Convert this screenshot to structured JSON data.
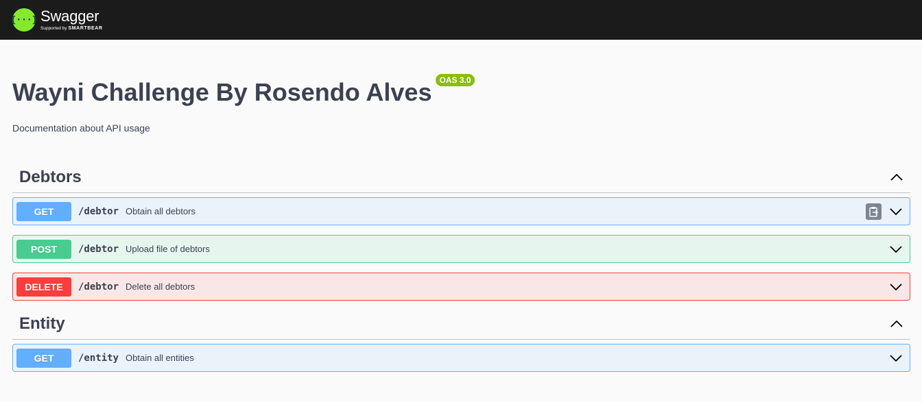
{
  "topbar": {
    "logo_mark": "{···}",
    "brand": "Swagger",
    "supported_by": "Supported by",
    "smartbear": "SMARTBEAR"
  },
  "info": {
    "title": "Wayni Challenge By Rosendo Alves",
    "version_badge": "OAS 3.0",
    "description": "Documentation about API usage"
  },
  "tags": [
    {
      "name": "Debtors",
      "toggle_icon": "chevron-up-icon",
      "operations": [
        {
          "method": "GET",
          "path": "/debtor",
          "summary": "Obtain all debtors"
        },
        {
          "method": "POST",
          "path": "/debtor",
          "summary": "Upload file of debtors"
        },
        {
          "method": "DELETE",
          "path": "/debtor",
          "summary": "Delete all debtors"
        }
      ]
    },
    {
      "name": "Entity",
      "toggle_icon": "chevron-up-icon",
      "operations": [
        {
          "method": "GET",
          "path": "/entity",
          "summary": "Obtain all entities"
        }
      ]
    }
  ],
  "colors": {
    "get": "#61affe",
    "post": "#49cc90",
    "delete": "#f93e3e",
    "badge": "#89bf04",
    "topbar": "#1b1b1b",
    "logo": "#85ea2d"
  }
}
